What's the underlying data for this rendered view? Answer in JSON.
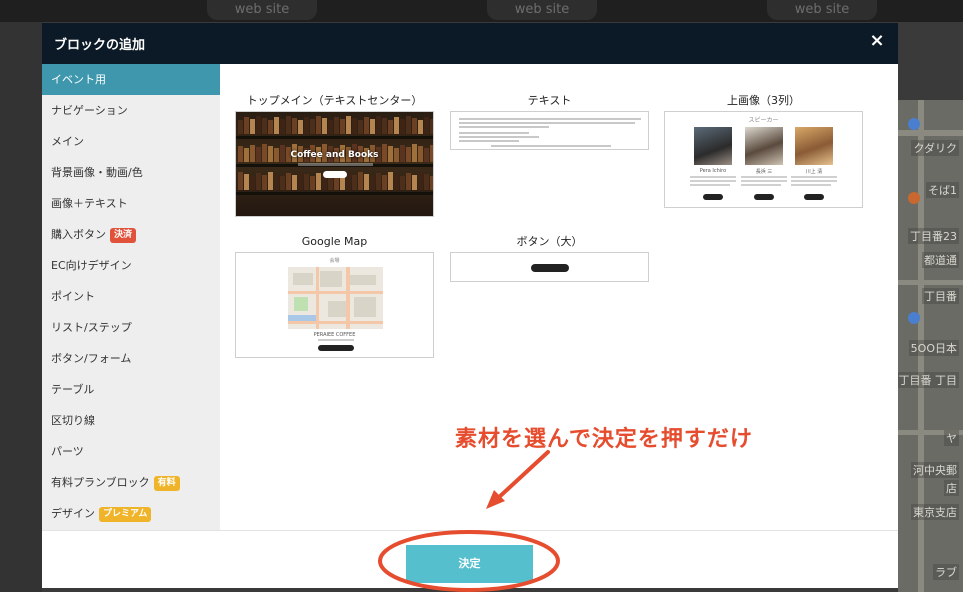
{
  "background": {
    "site_labels": [
      "web site",
      "web site",
      "web site"
    ],
    "map_labels": [
      "クダリク",
      "そば1",
      "丁目番23",
      "都道通",
      "丁目番",
      "5OO日本",
      "丁目番 丁目",
      "ヤ",
      "河中央郵",
      "店",
      "東京支店",
      "ラブ"
    ]
  },
  "modal": {
    "title": "ブロックの追加",
    "close_label": "×"
  },
  "sidebar": {
    "items": [
      {
        "label": "イベント用",
        "badge": "",
        "badge_color": ""
      },
      {
        "label": "ナビゲーション",
        "badge": "",
        "badge_color": ""
      },
      {
        "label": "メイン",
        "badge": "",
        "badge_color": ""
      },
      {
        "label": "背景画像・動画/色",
        "badge": "",
        "badge_color": ""
      },
      {
        "label": "画像＋テキスト",
        "badge": "",
        "badge_color": ""
      },
      {
        "label": "購入ボタン",
        "badge": "決済",
        "badge_color": "#e0533a"
      },
      {
        "label": "EC向けデザイン",
        "badge": "",
        "badge_color": ""
      },
      {
        "label": "ポイント",
        "badge": "",
        "badge_color": ""
      },
      {
        "label": "リスト/ステップ",
        "badge": "",
        "badge_color": ""
      },
      {
        "label": "ボタン/フォーム",
        "badge": "",
        "badge_color": ""
      },
      {
        "label": "テーブル",
        "badge": "",
        "badge_color": ""
      },
      {
        "label": "区切り線",
        "badge": "",
        "badge_color": ""
      },
      {
        "label": "パーツ",
        "badge": "",
        "badge_color": ""
      },
      {
        "label": "有料プランブロック",
        "badge": "有料",
        "badge_color": "#f0b42a"
      },
      {
        "label": "デザイン",
        "badge": "プレミアム",
        "badge_color": "#f0b42a"
      }
    ],
    "active_index": 0
  },
  "blocks": [
    {
      "title": "トップメイン（テキストセンター）",
      "headline": "Coffee and Books"
    },
    {
      "title": "テキスト"
    },
    {
      "title": "上画像（3列）",
      "heading": "スピーカー",
      "names": [
        "Pera Ichiro",
        "長浜 三",
        "川上 清"
      ]
    },
    {
      "title": "Google Map",
      "heading": "会場",
      "caption": "PERAIEE COFFEE"
    },
    {
      "title": "ボタン（大）"
    }
  ],
  "footer": {
    "confirm_label": "決定"
  },
  "annotation": {
    "text": "素材を選んで決定を押すだけ",
    "color": "#e64c2e"
  },
  "colors": {
    "header_bg": "#0b1a26",
    "active_item": "#3f97ad",
    "confirm_btn": "#55bfce"
  }
}
